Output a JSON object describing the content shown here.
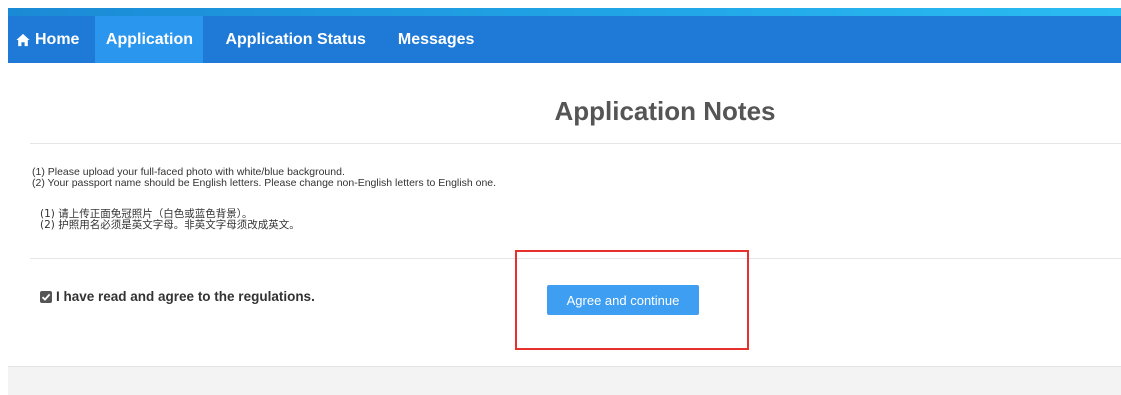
{
  "nav": {
    "items": [
      {
        "label": "Home",
        "icon": "home-icon",
        "active": false
      },
      {
        "label": "Application",
        "active": true
      },
      {
        "label": "Application Status",
        "active": false
      },
      {
        "label": "Messages",
        "active": false
      }
    ]
  },
  "page": {
    "title": "Application Notes"
  },
  "notes": {
    "en": [
      "(1) Please upload your full-faced photo with white/blue background.",
      "(2) Your passport name should be English letters. Please change non-English letters to English one."
    ],
    "cn": [
      "(1) 请上传正面免冠照片（白色或蓝色背景）。",
      "(2) 护照用名必须是英文字母。非英文字母须改成英文。"
    ]
  },
  "agreement": {
    "checkbox_checked": true,
    "checkbox_label": "I have read and agree to the regulations.",
    "button_label": "Agree and continue"
  },
  "colors": {
    "nav_bg": "#1e7ad6",
    "nav_active": "#2a96ee",
    "button": "#3d9ef2",
    "highlight": "#e8302e"
  }
}
